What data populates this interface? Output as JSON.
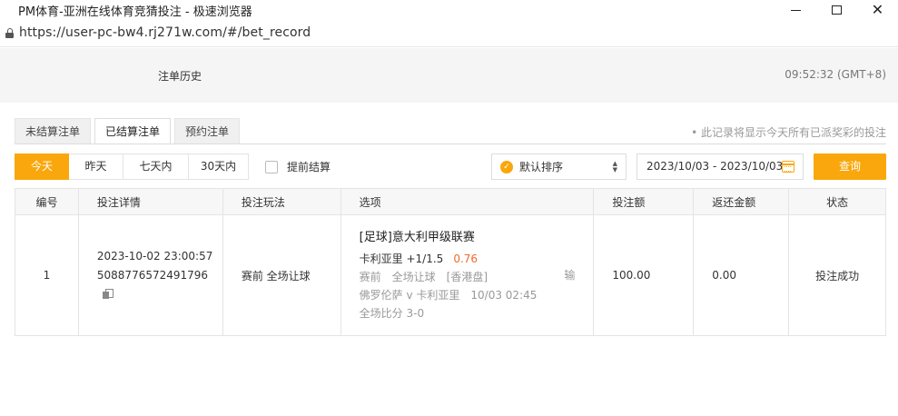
{
  "window": {
    "title": "PM体育-亚洲在线体育竞猜投注 - 极速浏览器"
  },
  "address": {
    "url": "https://user-pc-bw4.rj271w.com/#/bet_record"
  },
  "header": {
    "title": "注单历史",
    "clock": "09:52:32 (GMT+8)"
  },
  "tabs": [
    {
      "label": "未结算注单"
    },
    {
      "label": "已结算注单",
      "active": true
    },
    {
      "label": "预约注单"
    }
  ],
  "note": "• 此记录将显示今天所有已派奖彩的投注",
  "filters": {
    "periods": [
      {
        "label": "今天",
        "active": true
      },
      {
        "label": "昨天"
      },
      {
        "label": "七天内"
      },
      {
        "label": "30天内"
      }
    ],
    "early_settle_label": "提前结算",
    "sort_label": "默认排序",
    "date_range": "2023/10/03 - 2023/10/03",
    "query_label": "查询"
  },
  "table": {
    "columns": [
      "编号",
      "投注详情",
      "投注玩法",
      "选项",
      "投注额",
      "返还金额",
      "状态"
    ],
    "rows": [
      {
        "no": "1",
        "time": "2023-10-02 23:00:57",
        "bet_id": "5088776572491796",
        "play": "赛前 全场让球",
        "league": "[足球]意大利甲级联赛",
        "selection": "卡利亚里 +1/1.5",
        "odds": "0.76",
        "market": "赛前　全场让球　[香港盘]",
        "result": "输",
        "match": "佛罗伦萨 v 卡利亚里　10/03 02:45",
        "score": "全场比分 3-0",
        "stake": "100.00",
        "return": "0.00",
        "status": "投注成功"
      }
    ]
  },
  "colors": {
    "accent": "#f9a70c",
    "odds": "#f06b2e"
  }
}
